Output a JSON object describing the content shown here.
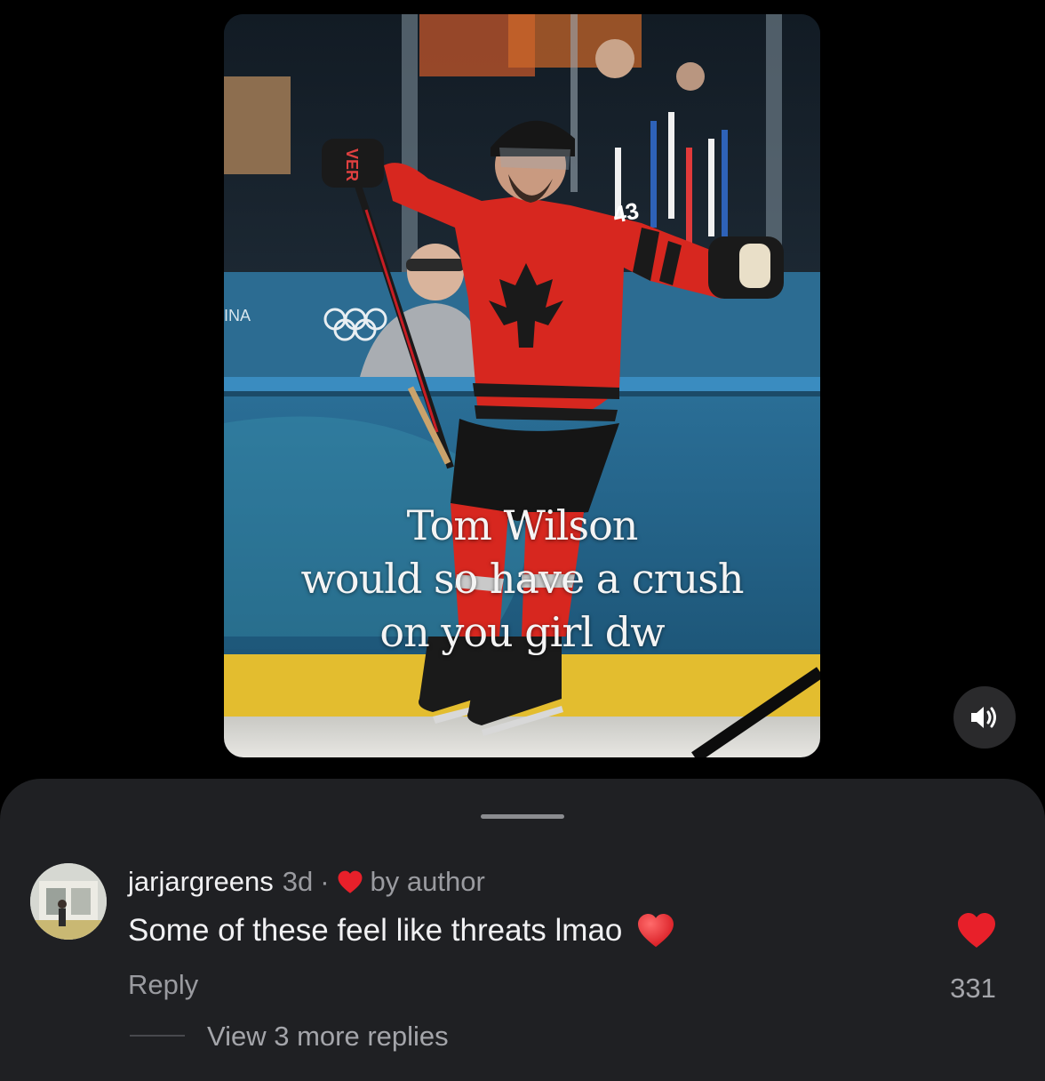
{
  "post": {
    "caption_lines": [
      "Tom Wilson",
      "would so have a crush",
      "on you girl dw"
    ],
    "jersey_number": "43",
    "stick_brand": "VER",
    "board_text": "INA"
  },
  "comment": {
    "username": "jarjargreens",
    "time": "3d",
    "separator": "·",
    "liked_by": "by author",
    "text": "Some of these feel like threats lmao",
    "reply_label": "Reply",
    "like_count": "331",
    "view_replies": "View 3 more replies"
  },
  "colors": {
    "heart": "#e8202a",
    "sheet_bg": "#1f2023",
    "secondary_text": "#9a9ba0"
  },
  "icons": {
    "sound": "speaker-icon",
    "author_like": "heart-icon",
    "emoji": "red-heart-emoji",
    "like": "heart-icon"
  }
}
